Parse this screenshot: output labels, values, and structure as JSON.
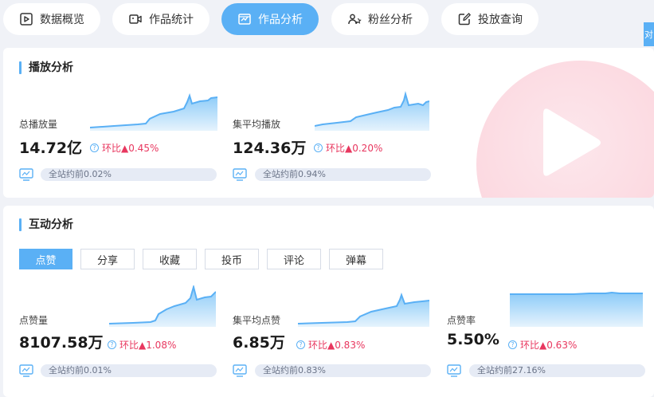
{
  "tabs": [
    {
      "label": "数据概览",
      "icon": "play-box-icon"
    },
    {
      "label": "作品统计",
      "icon": "video-camera-icon"
    },
    {
      "label": "作品分析",
      "icon": "chart-board-icon"
    },
    {
      "label": "粉丝分析",
      "icon": "fans-icon"
    },
    {
      "label": "投放查询",
      "icon": "edit-square-icon"
    }
  ],
  "active_tab": "作品分析",
  "edge_badge": "对",
  "play_section": {
    "title": "播放分析",
    "metrics": [
      {
        "label": "总播放量",
        "value": "14.72亿",
        "mom": "环比▲0.45%",
        "rank": "全站约前0.02%"
      },
      {
        "label": "集平均播放",
        "value": "124.36万",
        "mom": "环比▲0.20%",
        "rank": "全站约前0.94%"
      }
    ]
  },
  "interaction_section": {
    "title": "互动分析",
    "subtabs": [
      "点赞",
      "分享",
      "收藏",
      "投币",
      "评论",
      "弹幕"
    ],
    "active_subtab": "点赞",
    "metrics": [
      {
        "label": "点赞量",
        "value": "8107.58万",
        "mom": "环比▲1.08%",
        "rank": "全站约前0.01%"
      },
      {
        "label": "集平均点赞",
        "value": "6.85万",
        "mom": "环比▲0.83%",
        "rank": "全站约前0.83%"
      },
      {
        "label": "点赞率",
        "value": "5.50%",
        "mom": "环比▲0.63%",
        "rank": "全站约前27.16%"
      }
    ]
  },
  "colors": {
    "accent": "#5ab0f5",
    "up": "#e8375f",
    "rank_bg": "#e6ebf5"
  }
}
